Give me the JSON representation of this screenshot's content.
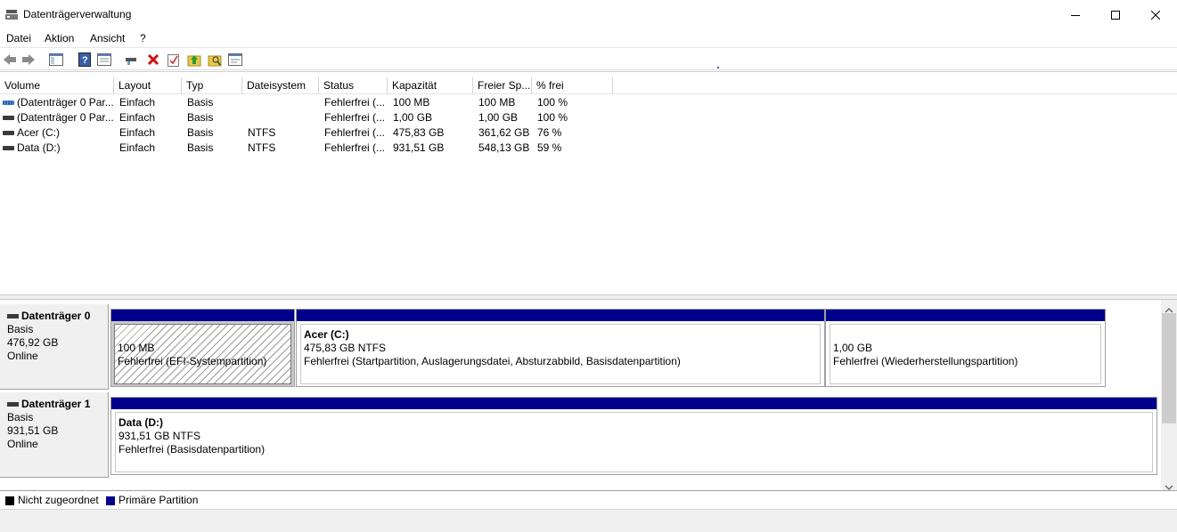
{
  "window": {
    "title": "Datenträgerverwaltung"
  },
  "menu": {
    "items": [
      "Datei",
      "Aktion",
      "Ansicht",
      "?"
    ]
  },
  "toolbar": {
    "icons": [
      "back-arrow-icon",
      "forward-arrow-icon",
      "console-tree-icon",
      "help-icon",
      "properties-icon",
      "connect-icon",
      "delete-icon",
      "check-icon",
      "up-icon",
      "search-icon",
      "details-icon"
    ]
  },
  "list": {
    "columns": [
      "Volume",
      "Layout",
      "Typ",
      "Dateisystem",
      "Status",
      "Kapazität",
      "Freier Sp...",
      "% frei"
    ],
    "rows": [
      {
        "volume": "(Datenträger 0 Par...",
        "layout": "Einfach",
        "typ": "Basis",
        "fs": "",
        "status": "Fehlerfrei (...",
        "kapazitaet": "100 MB",
        "frei": "100 MB",
        "prozent": "100 %"
      },
      {
        "volume": "(Datenträger 0 Par...",
        "layout": "Einfach",
        "typ": "Basis",
        "fs": "",
        "status": "Fehlerfrei (...",
        "kapazitaet": "1,00 GB",
        "frei": "1,00 GB",
        "prozent": "100 %"
      },
      {
        "volume": "Acer (C:)",
        "layout": "Einfach",
        "typ": "Basis",
        "fs": "NTFS",
        "status": "Fehlerfrei (...",
        "kapazitaet": "475,83 GB",
        "frei": "361,62 GB",
        "prozent": "76 %"
      },
      {
        "volume": "Data (D:)",
        "layout": "Einfach",
        "typ": "Basis",
        "fs": "NTFS",
        "status": "Fehlerfrei (...",
        "kapazitaet": "931,51 GB",
        "frei": "548,13 GB",
        "prozent": "59 %"
      }
    ]
  },
  "disks": [
    {
      "name": "Datenträger 0",
      "type": "Basis",
      "size": "476,92 GB",
      "state": "Online",
      "partitions": [
        {
          "title": "",
          "size": "100 MB",
          "status": "Fehlerfrei (EFI-Systempartition)"
        },
        {
          "title": "Acer  (C:)",
          "size": "475,83 GB NTFS",
          "status": "Fehlerfrei (Startpartition, Auslagerungsdatei, Absturzabbild, Basisdatenpartition)"
        },
        {
          "title": "",
          "size": "1,00 GB",
          "status": "Fehlerfrei (Wiederherstellungspartition)"
        }
      ]
    },
    {
      "name": "Datenträger 1",
      "type": "Basis",
      "size": "931,51 GB",
      "state": "Online",
      "partitions": [
        {
          "title": "Data  (D:)",
          "size": "931,51 GB NTFS",
          "status": "Fehlerfrei (Basisdatenpartition)"
        }
      ]
    }
  ],
  "legend": [
    {
      "label": "Nicht zugeordnet",
      "color": "#000000"
    },
    {
      "label": "Primäre Partition",
      "color": "#00008b"
    }
  ]
}
